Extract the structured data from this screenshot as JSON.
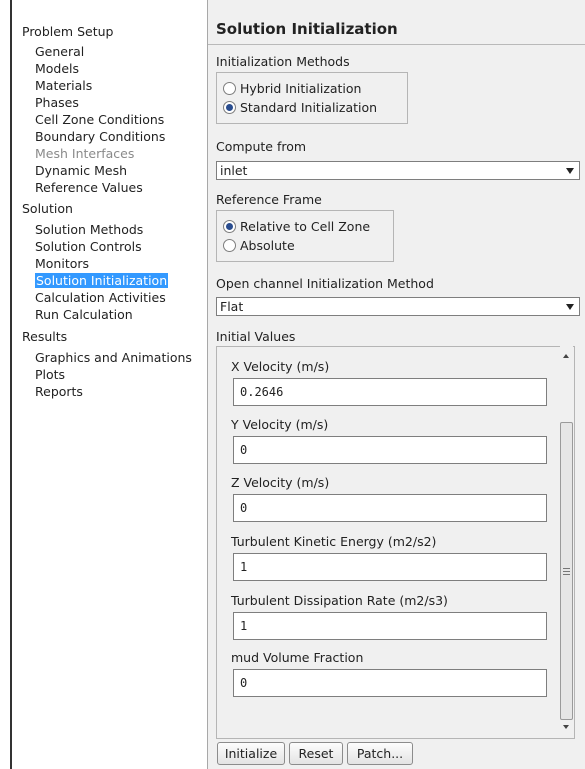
{
  "tree": {
    "categories": [
      {
        "label": "Problem Setup",
        "items": [
          {
            "label": "General",
            "state": "normal"
          },
          {
            "label": "Models",
            "state": "normal"
          },
          {
            "label": "Materials",
            "state": "normal"
          },
          {
            "label": "Phases",
            "state": "normal"
          },
          {
            "label": "Cell Zone Conditions",
            "state": "normal"
          },
          {
            "label": "Boundary Conditions",
            "state": "normal"
          },
          {
            "label": "Mesh Interfaces",
            "state": "disabled"
          },
          {
            "label": "Dynamic Mesh",
            "state": "normal"
          },
          {
            "label": "Reference Values",
            "state": "normal"
          }
        ]
      },
      {
        "label": "Solution",
        "items": [
          {
            "label": "Solution Methods",
            "state": "normal"
          },
          {
            "label": "Solution Controls",
            "state": "normal"
          },
          {
            "label": "Monitors",
            "state": "normal"
          },
          {
            "label": "Solution Initialization",
            "state": "selected"
          },
          {
            "label": "Calculation Activities",
            "state": "normal"
          },
          {
            "label": "Run Calculation",
            "state": "normal"
          }
        ]
      },
      {
        "label": "Results",
        "items": [
          {
            "label": "Graphics and Animations",
            "state": "normal"
          },
          {
            "label": "Plots",
            "state": "normal"
          },
          {
            "label": "Reports",
            "state": "normal"
          }
        ]
      }
    ]
  },
  "panel": {
    "title": "Solution Initialization",
    "init_methods": {
      "label": "Initialization Methods",
      "options": [
        "Hybrid  Initialization",
        "Standard Initialization"
      ],
      "selected": 1
    },
    "compute_from": {
      "label": "Compute from",
      "value": "inlet"
    },
    "reference_frame": {
      "label": "Reference Frame",
      "options": [
        "Relative to Cell Zone",
        "Absolute"
      ],
      "selected": 0
    },
    "open_channel": {
      "label": "Open channel Initialization Method",
      "value": "Flat"
    },
    "initial_values": {
      "label": "Initial Values",
      "fields": [
        {
          "label": "X Velocity (m/s)",
          "value": "0.2646"
        },
        {
          "label": "Y Velocity (m/s)",
          "value": "0"
        },
        {
          "label": "Z Velocity (m/s)",
          "value": "0"
        },
        {
          "label": "Turbulent Kinetic Energy (m2/s2)",
          "value": "1"
        },
        {
          "label": "Turbulent Dissipation Rate (m2/s3)",
          "value": "1"
        },
        {
          "label": "mud Volume Fraction",
          "value": "0"
        }
      ]
    },
    "buttons": {
      "initialize": "Initialize",
      "reset": "Reset",
      "patch": "Patch..."
    }
  },
  "colors": {
    "selection": "#3399ff",
    "panel_bg": "#f0f0f0",
    "disabled_text": "#8a8a8a"
  }
}
